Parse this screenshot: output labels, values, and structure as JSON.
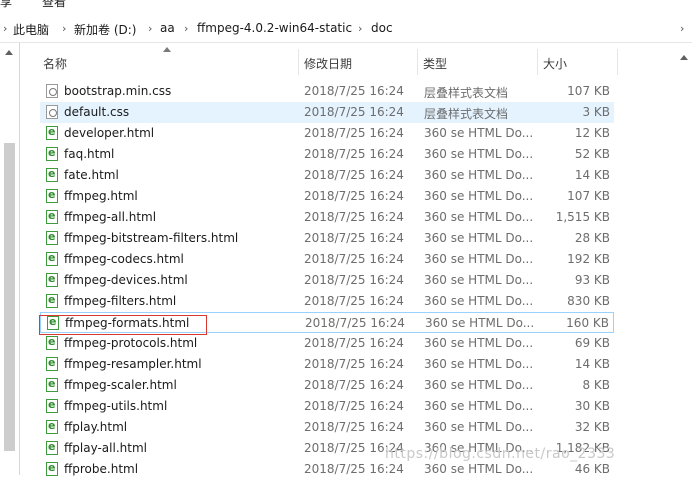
{
  "ribbon": {
    "left_fragment": "享",
    "right_fragment": "查看"
  },
  "address_bar": {
    "segments": [
      "此电脑",
      "新加卷 (D:)",
      "aa",
      "ffmpeg-4.0.2-win64-static",
      "doc"
    ]
  },
  "columns": {
    "name": "名称",
    "date": "修改日期",
    "type": "类型",
    "size": "大小"
  },
  "files": [
    {
      "name": "bootstrap.min.css",
      "date": "2018/7/25 16:24",
      "type": "层叠样式表文档",
      "size": "107 KB",
      "icon": "css-file-icon"
    },
    {
      "name": "default.css",
      "date": "2018/7/25 16:24",
      "type": "层叠样式表文档",
      "size": "3 KB",
      "icon": "css-file-icon"
    },
    {
      "name": "developer.html",
      "date": "2018/7/25 16:24",
      "type": "360 se HTML Do...",
      "size": "12 KB",
      "icon": "html-file-icon"
    },
    {
      "name": "faq.html",
      "date": "2018/7/25 16:24",
      "type": "360 se HTML Do...",
      "size": "52 KB",
      "icon": "html-file-icon"
    },
    {
      "name": "fate.html",
      "date": "2018/7/25 16:24",
      "type": "360 se HTML Do...",
      "size": "14 KB",
      "icon": "html-file-icon"
    },
    {
      "name": "ffmpeg.html",
      "date": "2018/7/25 16:24",
      "type": "360 se HTML Do...",
      "size": "107 KB",
      "icon": "html-file-icon"
    },
    {
      "name": "ffmpeg-all.html",
      "date": "2018/7/25 16:24",
      "type": "360 se HTML Do...",
      "size": "1,515 KB",
      "icon": "html-file-icon"
    },
    {
      "name": "ffmpeg-bitstream-filters.html",
      "date": "2018/7/25 16:24",
      "type": "360 se HTML Do...",
      "size": "28 KB",
      "icon": "html-file-icon"
    },
    {
      "name": "ffmpeg-codecs.html",
      "date": "2018/7/25 16:24",
      "type": "360 se HTML Do...",
      "size": "192 KB",
      "icon": "html-file-icon"
    },
    {
      "name": "ffmpeg-devices.html",
      "date": "2018/7/25 16:24",
      "type": "360 se HTML Do...",
      "size": "93 KB",
      "icon": "html-file-icon"
    },
    {
      "name": "ffmpeg-filters.html",
      "date": "2018/7/25 16:24",
      "type": "360 se HTML Do...",
      "size": "830 KB",
      "icon": "html-file-icon"
    },
    {
      "name": "ffmpeg-formats.html",
      "date": "2018/7/25 16:24",
      "type": "360 se HTML Do...",
      "size": "160 KB",
      "icon": "html-file-icon"
    },
    {
      "name": "ffmpeg-protocols.html",
      "date": "2018/7/25 16:24",
      "type": "360 se HTML Do...",
      "size": "69 KB",
      "icon": "html-file-icon"
    },
    {
      "name": "ffmpeg-resampler.html",
      "date": "2018/7/25 16:24",
      "type": "360 se HTML Do...",
      "size": "14 KB",
      "icon": "html-file-icon"
    },
    {
      "name": "ffmpeg-scaler.html",
      "date": "2018/7/25 16:24",
      "type": "360 se HTML Do...",
      "size": "8 KB",
      "icon": "html-file-icon"
    },
    {
      "name": "ffmpeg-utils.html",
      "date": "2018/7/25 16:24",
      "type": "360 se HTML Do...",
      "size": "30 KB",
      "icon": "html-file-icon"
    },
    {
      "name": "ffplay.html",
      "date": "2018/7/25 16:24",
      "type": "360 se HTML Do...",
      "size": "32 KB",
      "icon": "html-file-icon"
    },
    {
      "name": "ffplay-all.html",
      "date": "2018/7/25 16:24",
      "type": "360 se HTML Do...",
      "size": "1,182 KB",
      "icon": "html-file-icon"
    },
    {
      "name": "ffprobe.html",
      "date": "2018/7/25 16:24",
      "type": "360 se HTML Do...",
      "size": "46 KB",
      "icon": "html-file-icon"
    }
  ],
  "selected_file": "default.css",
  "highlighted_file": "ffmpeg-formats.html",
  "colors": {
    "selection": "#e5f3ff",
    "hover_border": "#99d1ff",
    "annotation_box": "#d9382f"
  },
  "watermark": "https://blog.csdn.net/rao_2333"
}
